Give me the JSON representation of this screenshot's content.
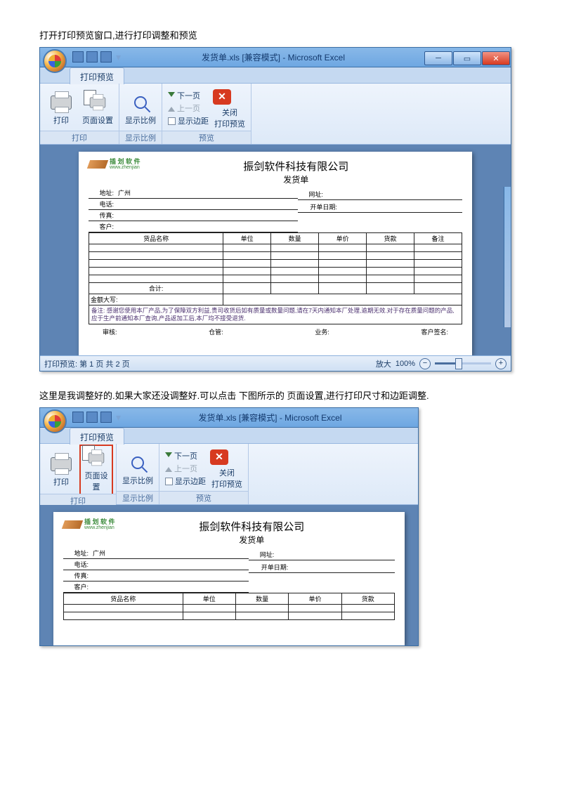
{
  "captions": {
    "c1": "打开打印预览窗口,进行打印调整和预览",
    "c2": "这里是我调整好的.如果大家还没调整好.可以点击 下图所示的 页面设置,进行打印尺寸和边距调整."
  },
  "window": {
    "title": "发货单.xls [兼容模式] - Microsoft Excel",
    "tab": "打印预览"
  },
  "ribbon": {
    "print": "打印",
    "page_setup": "页面设置",
    "zoom": "显示比例",
    "next_page": "下一页",
    "prev_page": "上一页",
    "show_margins": "显示边距",
    "close": "关闭",
    "close2": "打印预览",
    "group_print": "打印",
    "group_zoom": "显示比例",
    "group_preview": "预览"
  },
  "status": {
    "page_of": "打印预览: 第 1 页 共 2 页",
    "zoom_label": "放大",
    "zoom_pct": "100%"
  },
  "doc": {
    "company": "振剑软件科技有限公司",
    "sheet_name": "发货单",
    "logo_txt": "插 划 软 件",
    "logo_sub": "www.zhenjian",
    "labels": {
      "addr": "地址:",
      "addr_v": "广州",
      "tel": "电话:",
      "fax": "传真:",
      "cust": "客户:",
      "web": "网址:",
      "date": "开单日期:"
    },
    "headers": [
      "货品名称",
      "单位",
      "数量",
      "单价",
      "货款",
      "备注"
    ],
    "sum": "合计:",
    "amt_words": "金额大写:",
    "note": "备注: 感谢您使用本厂产品,为了保障双方利益,贵司收货后如有质量或数量问题,请在7天内通知本厂处理,逾期无效.对于存在质量问题的产品,应于生产前通知本厂查询,产品返加工后,本厂均不接受退货.",
    "signs": {
      "a": "审核:",
      "b": "仓管:",
      "c": "业务:",
      "d": "客户签名:"
    }
  }
}
